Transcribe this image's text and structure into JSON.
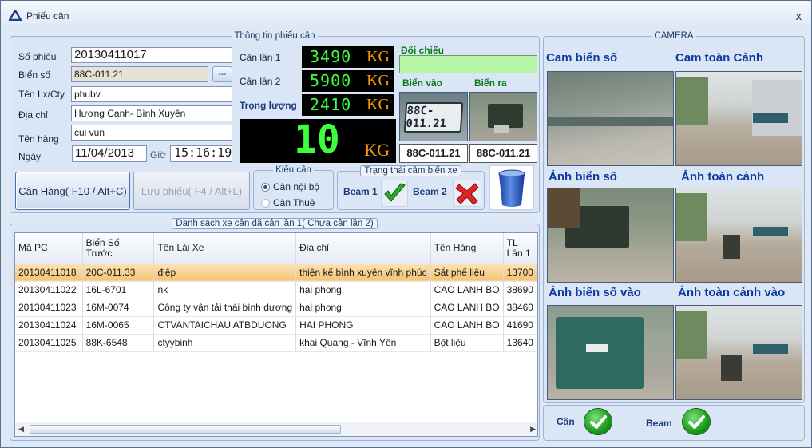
{
  "window": {
    "title": "Phiếu cân",
    "close_label": "x"
  },
  "ticket": {
    "legend": "Thông tin phiếu cân",
    "labels": {
      "so_phieu": "Số phiếu",
      "bien_so": "Biển số",
      "ten_lx": "Tên Lx/Cty",
      "dia_chi": "Địa chỉ",
      "ten_hang": "Tên hàng",
      "ngay": "Ngày",
      "gio": "Giờ"
    },
    "values": {
      "so_phieu": "20130411017",
      "bien_so": "88C-011.21",
      "ten_lx": "phubv",
      "dia_chi": "Hương Canh- Bình Xuyên",
      "ten_hang": "cui vun",
      "ngay": "11/04/2013",
      "gio": "15:16:19"
    },
    "browse_label": "---"
  },
  "weights": {
    "can_lan_1": {
      "label": "Cân lần 1",
      "value": "3490",
      "unit": "KG"
    },
    "can_lan_2": {
      "label": "Cân lần 2",
      "value": "5900",
      "unit": "KG"
    },
    "trong_luong": {
      "label": "Trọng lượng",
      "value": "2410",
      "unit": "KG"
    },
    "live": {
      "value": "10",
      "unit": "KG"
    }
  },
  "compare": {
    "label": "Đối chiếu",
    "bien_vao_label": "Biển vào",
    "bien_ra_label": "Biển ra",
    "plate_in": "88C-011.21",
    "plate_out": "88C-011.21",
    "plate_photo_text": "88C-011.21"
  },
  "buttons": {
    "can_hang": "Cân Hàng( F10 / Alt+C)",
    "luu_phieu": "Lưu phiếu( F4 / Alt+L)"
  },
  "kieu_can": {
    "legend": "Kiểu cân",
    "options": [
      "Cân nội bộ",
      "Cân Thuê"
    ],
    "selected": "Cân nội bộ"
  },
  "sensor": {
    "legend": "Trạng thái cảm biến xe",
    "beam1": "Beam 1",
    "beam2": "Beam 2"
  },
  "table": {
    "legend": "Danh sách xe cân đã cân lần 1( Chưa cân lần 2)",
    "columns": [
      "Mã PC",
      "Biển Số\nTrước",
      "Tên Lái Xe",
      "Địa chỉ",
      "Tên Hàng",
      "TL\nLần 1"
    ],
    "rows": [
      [
        "20130411018",
        "20C-011.33",
        "điệp",
        "thiện kế bình xuyên vĩnh phúc",
        "Sắt phế liệu",
        "13700"
      ],
      [
        "20130411022",
        "16L-6701",
        "nk",
        "hai phong",
        "CAO LANH BO",
        "38690"
      ],
      [
        "20130411023",
        "16M-0074",
        "Công ty vận tải thái bình dương",
        "hai phong",
        "CAO LANH BO",
        "38460"
      ],
      [
        "20130411024",
        "16M-0065",
        "CTVANTAICHAU ATBDUONG",
        "HAI PHONG",
        "CAO LANH BO",
        "41690"
      ],
      [
        "20130411025",
        "88K-6548",
        "ctyybinh",
        "khai Quang - Vĩnh Yên",
        "Bột liệu",
        "13640"
      ]
    ],
    "selected_row": 0
  },
  "camera": {
    "legend": "CAMERA",
    "labels": [
      "Cam biển số",
      "Cam toàn Cảnh",
      "Ảnh biển số",
      "Ảnh toàn cảnh",
      "Ảnh biển số vào",
      "Ảnh toàn cảnh vào"
    ]
  },
  "status": {
    "can": "Cân",
    "beam": "Beam"
  },
  "colors": {
    "lcd_digits": "#3dff3d",
    "lcd_unit": "#ff9a00",
    "accent": "#0d3a9c",
    "selected_row": "#f6c272"
  }
}
